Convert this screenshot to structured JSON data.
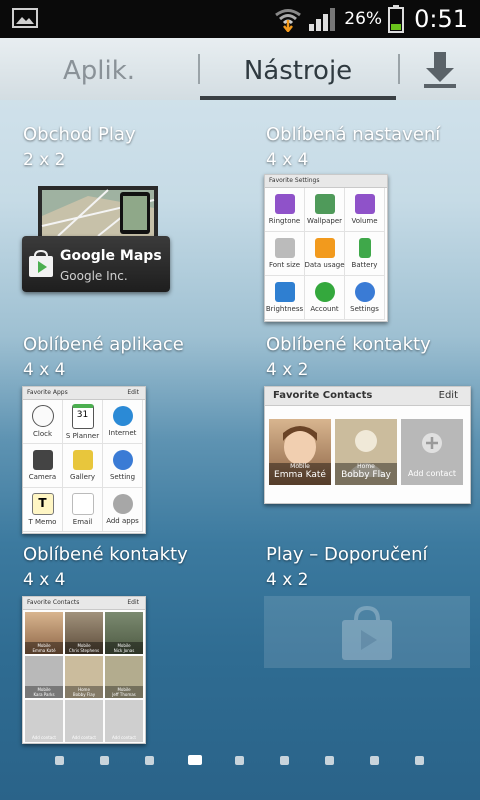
{
  "status_bar": {
    "icons": [
      "picture-icon",
      "wifi-download-icon",
      "signal-icon",
      "battery-icon"
    ],
    "battery": "26%",
    "time": "0:51"
  },
  "tabs": {
    "apps": "Aplik.",
    "widgets": "Nástroje",
    "active": "widgets"
  },
  "widgets": [
    {
      "title": "Obchod Play",
      "size": "2 x 2",
      "preview": {
        "app": "Google Maps",
        "developer": "Google Inc.",
        "icon": "play-store-icon"
      }
    },
    {
      "title": "Oblíbená nastavení",
      "size": "4 x 4",
      "preview": {
        "header": "Favorite Settings",
        "items": [
          "Ringtone",
          "Wallpaper",
          "Volume",
          "Font size",
          "Data usage",
          "Battery",
          "Brightness",
          "Account",
          "Settings"
        ]
      }
    },
    {
      "title": "Oblíbené aplikace",
      "size": "4 x 4",
      "preview": {
        "header": "Favorite Apps",
        "edit": "Edit",
        "items": [
          "Clock",
          "S Planner",
          "Internet",
          "Camera",
          "Gallery",
          "Setting",
          "T Memo",
          "Email",
          "Add apps"
        ]
      }
    },
    {
      "title": "Oblíbené kontakty",
      "size": "4 x 2",
      "preview": {
        "header": "Favorite Contacts",
        "edit": "Edit",
        "contacts": [
          {
            "tag": "Mobile",
            "name": "Emma Katé"
          },
          {
            "tag": "Home",
            "name": "Bobby Flay"
          }
        ],
        "add": "Add contact"
      }
    },
    {
      "title": "Oblíbené kontakty",
      "size": "4 x 4",
      "preview": {
        "header": "Favorite Contacts",
        "edit": "Edit",
        "contacts": [
          {
            "tag": "Mobile",
            "name": "Emma Katé"
          },
          {
            "tag": "Mobile",
            "name": "Chris Stephens"
          },
          {
            "tag": "Mobile",
            "name": "Nick Jonas"
          },
          {
            "tag": "Mobile",
            "name": "Kara Parks"
          },
          {
            "tag": "Home",
            "name": "Bobby Flay"
          },
          {
            "tag": "Mobile",
            "name": "Jeff Thomas"
          }
        ],
        "add": "Add contact"
      }
    },
    {
      "title": "Play – Doporučení",
      "size": "4 x 2"
    }
  ],
  "pagination": {
    "pages": 9,
    "current": 4
  },
  "colors": {
    "status_bg": "#0a0a0a",
    "battery_green": "#6ac41c",
    "sky": "#c6dbe6",
    "sea": "#2f6c92"
  }
}
